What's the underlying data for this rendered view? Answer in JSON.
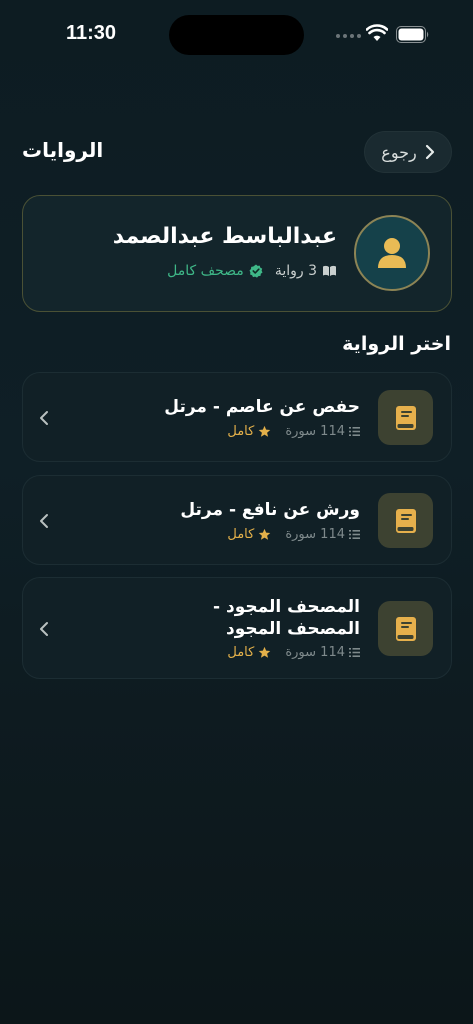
{
  "status_bar": {
    "time": "11:30"
  },
  "header": {
    "title": "الروايات",
    "back_label": "رجوع"
  },
  "reciter": {
    "name": "عبدالباسط عبدالصمد",
    "riwaya_count": "3 رواية",
    "mushaf_status": "مصحف كامل"
  },
  "section_title": "اختر الرواية",
  "riwayat": [
    {
      "title": "حفص عن عاصم - مرتل",
      "surah_count": "114 سورة",
      "status": "كامل"
    },
    {
      "title": "ورش عن نافع - مرتل",
      "surah_count": "114 سورة",
      "status": "كامل"
    },
    {
      "title": "المصحف المجود - المصحف المجود",
      "surah_count": "114 سورة",
      "status": "كامل"
    }
  ],
  "colors": {
    "accent_gold": "#e3b04a",
    "accent_green": "#3fb888",
    "background": "#0d1c22"
  }
}
